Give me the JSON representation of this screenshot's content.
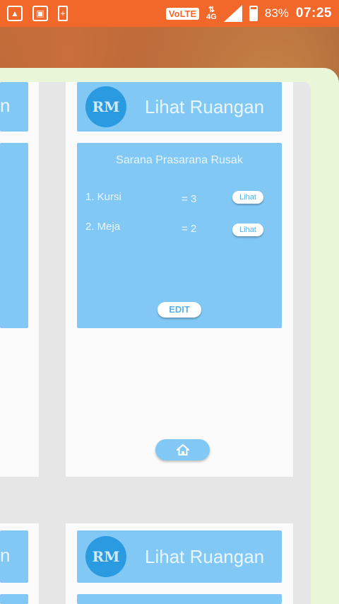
{
  "statusbar": {
    "network_badge": "VoLTE",
    "network_type": "4G",
    "battery_percent": "83%",
    "time": "07:25"
  },
  "card_left": {
    "title_fragment": "n"
  },
  "card_right": {
    "header_title": "Lihat Ruangan",
    "avatar_text": "RM",
    "section_title": "Sarana Prasarana Rusak",
    "items": [
      {
        "name": "1. Kursi",
        "qty": "= 3",
        "action": "Lihat"
      },
      {
        "name": "2. Meja",
        "qty": "= 2",
        "action": "Lihat"
      }
    ],
    "edit_label": "EDIT",
    "home_icon": "home-icon"
  },
  "card_left_bottom": {
    "title_fragment": "n"
  },
  "card_right_bottom": {
    "header_title": "Lihat Ruangan",
    "avatar_text": "RM"
  },
  "colors": {
    "statusbar": "#f2682a",
    "card_blue": "#82c8f5",
    "avatar_blue": "#2a9be0"
  }
}
